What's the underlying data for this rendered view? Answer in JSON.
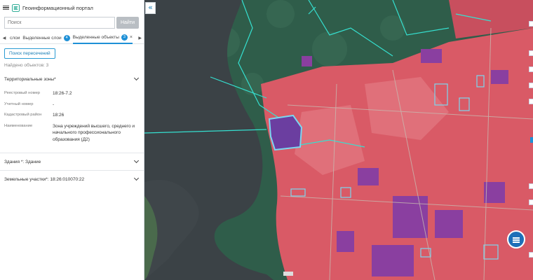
{
  "app": {
    "title": "Геоинформационный портал"
  },
  "search": {
    "placeholder": "Поиск",
    "button": "Найти"
  },
  "tabs": [
    {
      "label": "слои"
    },
    {
      "label": "Выделенные слои",
      "badge": "4"
    },
    {
      "label": "Выделенные объекты",
      "badge": "3"
    }
  ],
  "lookup_button": "Поиск пересечений",
  "found_count": "Найдено объектов: 3",
  "sections": {
    "zones": {
      "title": "Территориальные зоны*"
    },
    "buildings": {
      "title": "Здания *: Здание"
    },
    "land": {
      "title": "Земельные участки*: 18:26:010070:22"
    }
  },
  "details": [
    {
      "label": "Реестровый номер",
      "value": "18:26-7.2"
    },
    {
      "label": "Учетный номер",
      "value": "-"
    },
    {
      "label": "Кадастровый район",
      "value": "18:26"
    },
    {
      "label": "Наименование",
      "value": "Зона учреждений высшего, среднего и начального профессионального образования (Д2)"
    }
  ],
  "map": {
    "water_color": "#3b4246",
    "forest_color": "#2f5d4a",
    "zone_color": "#d95a66",
    "purple_color": "#8a3fa0",
    "outline_color": "#35e0d0",
    "highlight_color": "#7ad7f0"
  }
}
